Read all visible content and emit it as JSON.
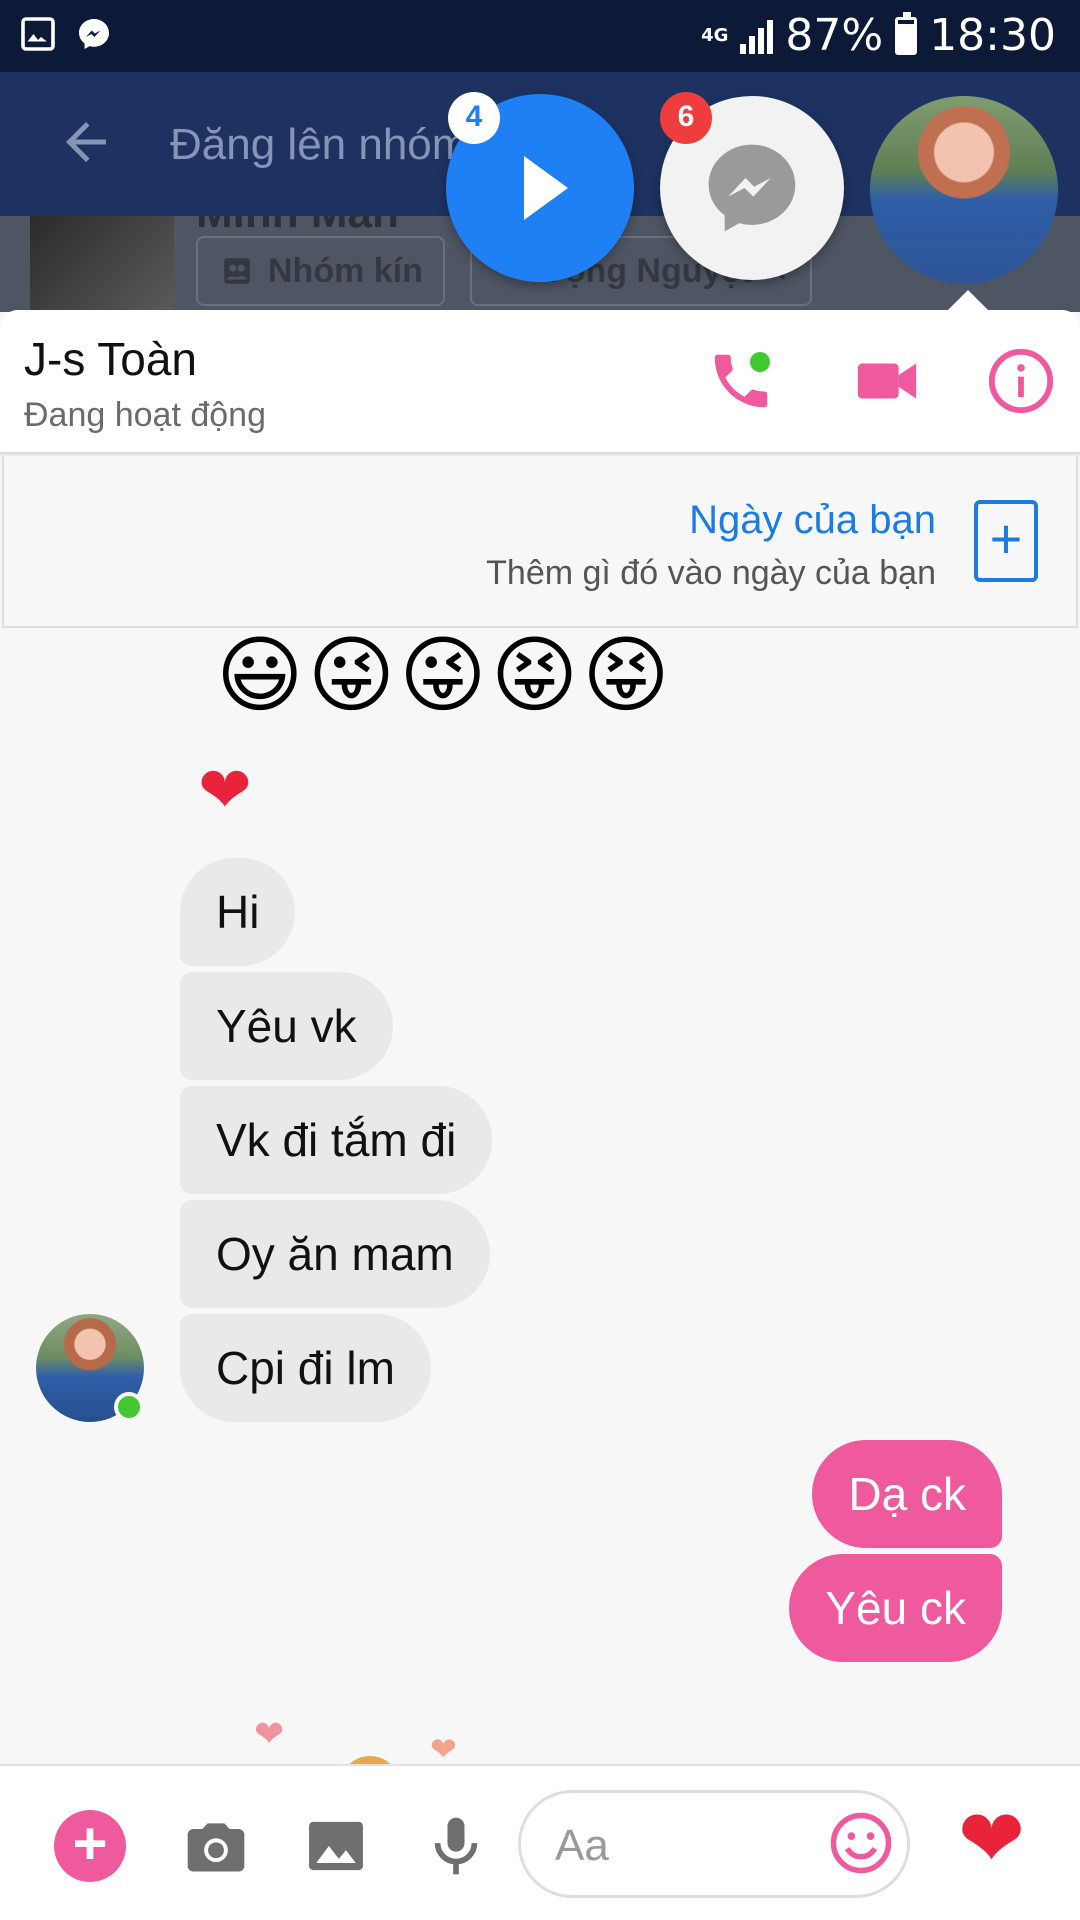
{
  "status_bar": {
    "network": "4G",
    "battery": "87%",
    "time": "18:30"
  },
  "background_app": {
    "title": "Đăng lên nhóm",
    "group_name_partial": "Minh Mẫn",
    "chip_closed_group": "Nhóm kín",
    "chip_member": "Vọng Nguyệt"
  },
  "chat_heads": {
    "video_badge": "4",
    "messenger_badge": "6"
  },
  "conversation": {
    "name": "J-s Toàn",
    "status": "Đang hoạt động"
  },
  "story_prompt": {
    "title": "Ngày của bạn",
    "subtitle": "Thêm gì đó vào ngày của bạn"
  },
  "messages": {
    "emojis": "😃😜😜😝😝",
    "heart": "❤",
    "incoming": [
      "Hi",
      "Yêu vk",
      "Vk đi tắm đi",
      "Oy ăn mam",
      "Cpi đi lm"
    ],
    "outgoing": [
      "Dạ ck",
      "Yêu ck"
    ]
  },
  "composer": {
    "placeholder": "Aa",
    "like": "❤"
  },
  "colors": {
    "accent": "#ef5a9e",
    "link": "#1b7be6",
    "online": "#42c830"
  }
}
